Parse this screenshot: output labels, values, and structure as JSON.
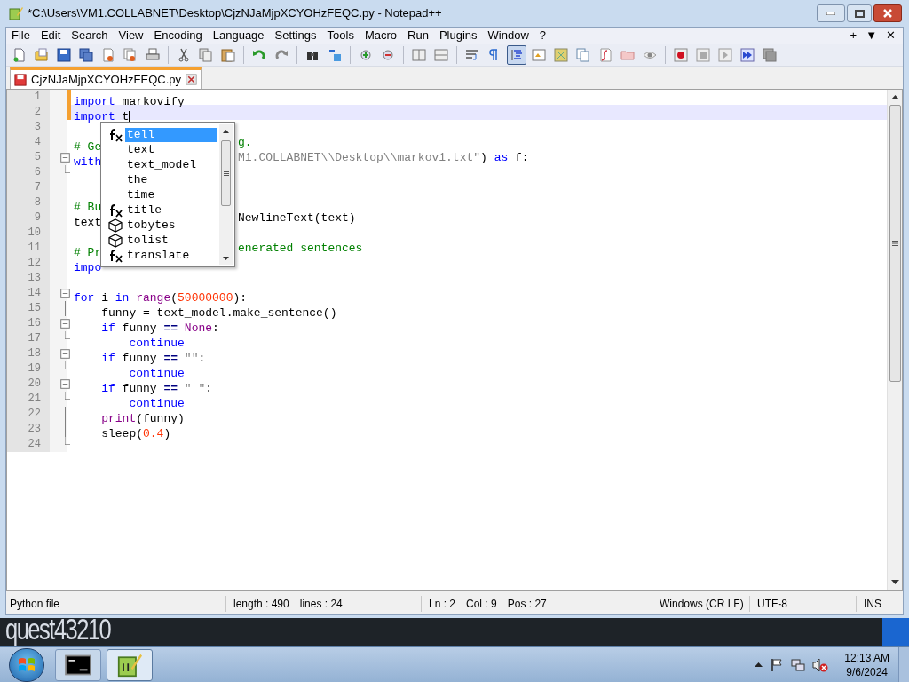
{
  "window": {
    "title": "*C:\\Users\\VM1.COLLABNET\\Desktop\\CjzNJaMjpXCYOHzFEQC.py - Notepad++"
  },
  "menu": [
    "File",
    "Edit",
    "Search",
    "View",
    "Encoding",
    "Language",
    "Settings",
    "Tools",
    "Macro",
    "Run",
    "Plugins",
    "Window",
    "?"
  ],
  "menu_right": [
    "+",
    "▼",
    "✕"
  ],
  "toolbar": [
    {
      "kind": "new",
      "pressed": false
    },
    {
      "kind": "open",
      "pressed": false
    },
    {
      "kind": "save",
      "pressed": false
    },
    {
      "kind": "saveall",
      "pressed": false
    },
    {
      "kind": "close",
      "pressed": false
    },
    {
      "kind": "closeall",
      "pressed": false
    },
    {
      "kind": "print",
      "pressed": false
    },
    {
      "kind": "sep"
    },
    {
      "kind": "cut",
      "pressed": false
    },
    {
      "kind": "copy",
      "pressed": false
    },
    {
      "kind": "paste",
      "pressed": false
    },
    {
      "kind": "sep"
    },
    {
      "kind": "undo",
      "pressed": false
    },
    {
      "kind": "redo",
      "pressed": false
    },
    {
      "kind": "sep"
    },
    {
      "kind": "find",
      "pressed": false
    },
    {
      "kind": "replace",
      "pressed": false
    },
    {
      "kind": "sep"
    },
    {
      "kind": "zoomin",
      "pressed": false
    },
    {
      "kind": "zoomout",
      "pressed": false
    },
    {
      "kind": "sep"
    },
    {
      "kind": "syncv",
      "pressed": false
    },
    {
      "kind": "synch",
      "pressed": false
    },
    {
      "kind": "sep"
    },
    {
      "kind": "wrap",
      "pressed": false
    },
    {
      "kind": "allchars",
      "pressed": false
    },
    {
      "kind": "indent",
      "pressed": true
    },
    {
      "kind": "lang",
      "pressed": false
    },
    {
      "kind": "map",
      "pressed": false
    },
    {
      "kind": "docs",
      "pressed": false
    },
    {
      "kind": "func",
      "pressed": false
    },
    {
      "kind": "folder",
      "pressed": false
    },
    {
      "kind": "eye",
      "pressed": false
    },
    {
      "kind": "sep"
    },
    {
      "kind": "record",
      "pressed": false
    },
    {
      "kind": "stop",
      "pressed": false
    },
    {
      "kind": "play",
      "pressed": false
    },
    {
      "kind": "playmulti",
      "pressed": false
    },
    {
      "kind": "savemacro",
      "pressed": false
    }
  ],
  "tabs": [
    {
      "label": "CjzNJaMjpXCYOHzFEQC.py",
      "selected": true,
      "modified": true
    }
  ],
  "editor": {
    "lines": [
      {
        "number": "1",
        "modified": true,
        "tokens": [
          {
            "kind": "kw",
            "text": "import"
          },
          {
            "kind": "plain",
            "text": " markovify"
          }
        ]
      },
      {
        "number": "2",
        "modified": true,
        "current": true,
        "caret": true,
        "tokens": [
          {
            "kind": "kw",
            "text": "import"
          },
          {
            "kind": "plain",
            "text": " t"
          }
        ]
      },
      {
        "number": "3"
      },
      {
        "number": "4",
        "tokens": [
          {
            "kind": "comment",
            "text": "# Ge"
          }
        ],
        "right_tokens": [
          {
            "kind": "comment",
            "text": "g."
          }
        ]
      },
      {
        "number": "5",
        "fold": {
          "kind": "start"
        },
        "tokens": [
          {
            "kind": "kw",
            "text": "with"
          }
        ],
        "right_tokens": [
          {
            "kind": "str",
            "text": "M1.COLLABNET\\\\Desktop\\\\markov1.txt\""
          },
          {
            "kind": "plain",
            "text": ") "
          },
          {
            "kind": "kw",
            "text": "as"
          },
          {
            "kind": "plain",
            "text": " f:"
          }
        ]
      },
      {
        "number": "6",
        "fold": {
          "kind": "end"
        }
      },
      {
        "number": "7"
      },
      {
        "number": "8",
        "tokens": [
          {
            "kind": "comment",
            "text": "# Bu"
          }
        ]
      },
      {
        "number": "9",
        "tokens": [
          {
            "kind": "plain",
            "text": "text"
          }
        ],
        "right_tokens": [
          {
            "kind": "plain",
            "text": "NewlineText(text)"
          }
        ]
      },
      {
        "number": "10"
      },
      {
        "number": "11",
        "tokens": [
          {
            "kind": "comment",
            "text": "# Pr"
          }
        ],
        "right_tokens": [
          {
            "kind": "comment",
            "text": "enerated sentences"
          }
        ]
      },
      {
        "number": "12",
        "tokens": [
          {
            "kind": "kw",
            "text": "impo"
          }
        ]
      },
      {
        "number": "13"
      },
      {
        "number": "14",
        "fold": {
          "kind": "start"
        },
        "tokens": [
          {
            "kind": "kw",
            "text": "for"
          },
          {
            "kind": "plain",
            "text": " i "
          },
          {
            "kind": "kw",
            "text": "in "
          },
          {
            "kind": "builtin",
            "text": "range"
          },
          {
            "kind": "plain",
            "text": "("
          },
          {
            "kind": "num",
            "text": "50000000"
          },
          {
            "kind": "plain",
            "text": "):"
          }
        ]
      },
      {
        "number": "15",
        "fold": {
          "kind": "line"
        },
        "tokens": [
          {
            "kind": "plain",
            "text": "    funny = text_model.make_sentence()"
          }
        ]
      },
      {
        "number": "16",
        "fold": {
          "kind": "start"
        },
        "tokens": [
          {
            "kind": "kw",
            "text": "    if"
          },
          {
            "kind": "plain",
            "text": " funny "
          },
          {
            "kind": "op",
            "text": "== "
          },
          {
            "kind": "builtin",
            "text": "None"
          },
          {
            "kind": "plain",
            "text": ":"
          }
        ]
      },
      {
        "number": "17",
        "fold": {
          "kind": "end"
        },
        "tokens": [
          {
            "kind": "kw",
            "text": "        continue"
          }
        ]
      },
      {
        "number": "18",
        "fold": {
          "kind": "start"
        },
        "tokens": [
          {
            "kind": "kw",
            "text": "    if"
          },
          {
            "kind": "plain",
            "text": " funny "
          },
          {
            "kind": "op",
            "text": "== "
          },
          {
            "kind": "str",
            "text": "\"\""
          },
          {
            "kind": "plain",
            "text": ":"
          }
        ]
      },
      {
        "number": "19",
        "fold": {
          "kind": "end"
        },
        "tokens": [
          {
            "kind": "kw",
            "text": "        continue"
          }
        ]
      },
      {
        "number": "20",
        "fold": {
          "kind": "start"
        },
        "tokens": [
          {
            "kind": "kw",
            "text": "    if"
          },
          {
            "kind": "plain",
            "text": " funny "
          },
          {
            "kind": "op",
            "text": "== "
          },
          {
            "kind": "str",
            "text": "\" \""
          },
          {
            "kind": "plain",
            "text": ":"
          }
        ]
      },
      {
        "number": "21",
        "fold": {
          "kind": "end"
        },
        "tokens": [
          {
            "kind": "kw",
            "text": "        continue"
          }
        ]
      },
      {
        "number": "22",
        "fold": {
          "kind": "line"
        },
        "tokens": [
          {
            "kind": "builtin",
            "text": "    print"
          },
          {
            "kind": "plain",
            "text": "(funny)"
          }
        ]
      },
      {
        "number": "23",
        "fold": {
          "kind": "line"
        },
        "tokens": [
          {
            "kind": "plain",
            "text": "    sleep("
          },
          {
            "kind": "num",
            "text": "0.4"
          },
          {
            "kind": "plain",
            "text": ")"
          }
        ]
      },
      {
        "number": "24",
        "fold": {
          "kind": "end"
        }
      }
    ]
  },
  "autocomplete": [
    {
      "kind": "function",
      "text": "tell",
      "selected": true
    },
    {
      "kind": "none",
      "text": "text",
      "selected": false
    },
    {
      "kind": "none",
      "text": "text_model",
      "selected": false
    },
    {
      "kind": "none",
      "text": "the",
      "selected": false
    },
    {
      "kind": "none",
      "text": "time",
      "selected": false
    },
    {
      "kind": "function",
      "text": "title",
      "selected": false
    },
    {
      "kind": "class",
      "text": "tobytes",
      "selected": false
    },
    {
      "kind": "class",
      "text": "tolist",
      "selected": false
    },
    {
      "kind": "function",
      "text": "translate",
      "selected": false
    }
  ],
  "status_bar": {
    "language": "Python file",
    "length": "length : 490",
    "lines": "lines : 24",
    "ln": "Ln : 2",
    "col": "Col : 9",
    "pos": "Pos : 27",
    "eol": "Windows (CR LF)",
    "encoding": "UTF-8",
    "mode": "INS"
  },
  "desktop": {
    "text": "quest43210"
  },
  "taskbar": {
    "apps": [
      {
        "kind": "console",
        "selected": false
      },
      {
        "kind": "notepad",
        "selected": true
      }
    ],
    "time": "12:13 AM",
    "date": "9/6/2024"
  }
}
